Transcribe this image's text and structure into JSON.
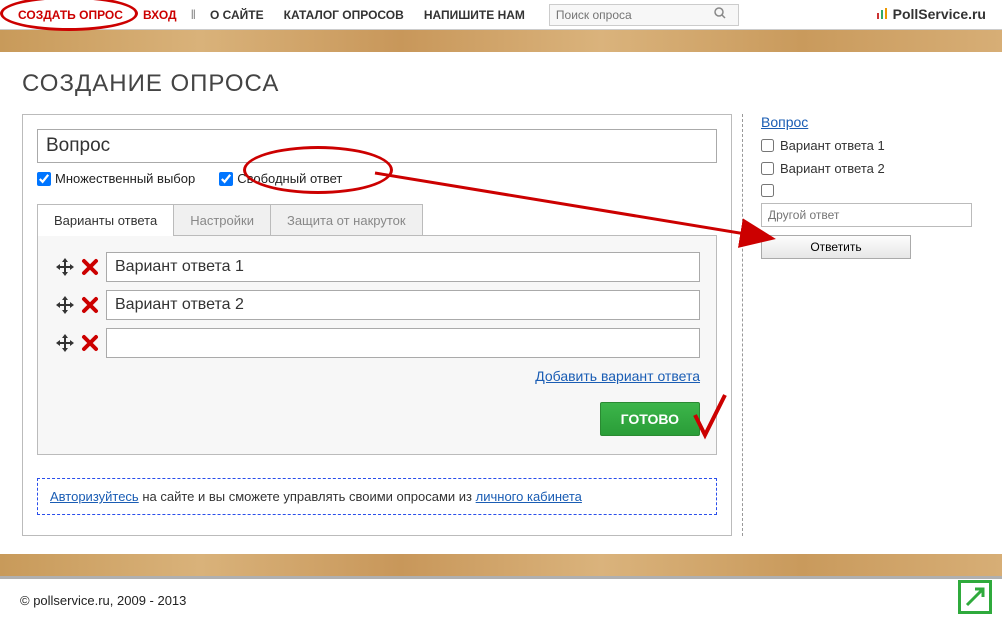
{
  "nav": {
    "create": "СОЗДАТЬ ОПРОС",
    "login": "ВХОД",
    "about": "О САЙТЕ",
    "catalog": "КАТАЛОГ ОПРОСОВ",
    "write": "НАПИШИТЕ НАМ",
    "search_placeholder": "Поиск опроса"
  },
  "brand": "PollService.ru",
  "page_title": "СОЗДАНИЕ ОПРОСА",
  "question": {
    "value": "Вопрос",
    "multi_label": "Множественный выбор",
    "free_label": "Свободный ответ"
  },
  "tabs": {
    "answers": "Варианты ответа",
    "settings": "Настройки",
    "anticheat": "Защита от накруток"
  },
  "answers": {
    "a1": "Вариант ответа 1",
    "a2": "Вариант ответа 2",
    "a3": ""
  },
  "add_answer": "Добавить вариант ответа",
  "done": "ГОТОВО",
  "auth": {
    "link1": "Авторизуйтесь",
    "mid": " на сайте и вы сможете управлять своими опросами из ",
    "link2": "личного кабинета"
  },
  "preview": {
    "title": "Вопрос",
    "opt1": "Вариант ответа 1",
    "opt2": "Вариант ответа 2",
    "other_placeholder": "Другой ответ",
    "submit": "Ответить"
  },
  "footer": "© pollservice.ru, 2009 - 2013"
}
